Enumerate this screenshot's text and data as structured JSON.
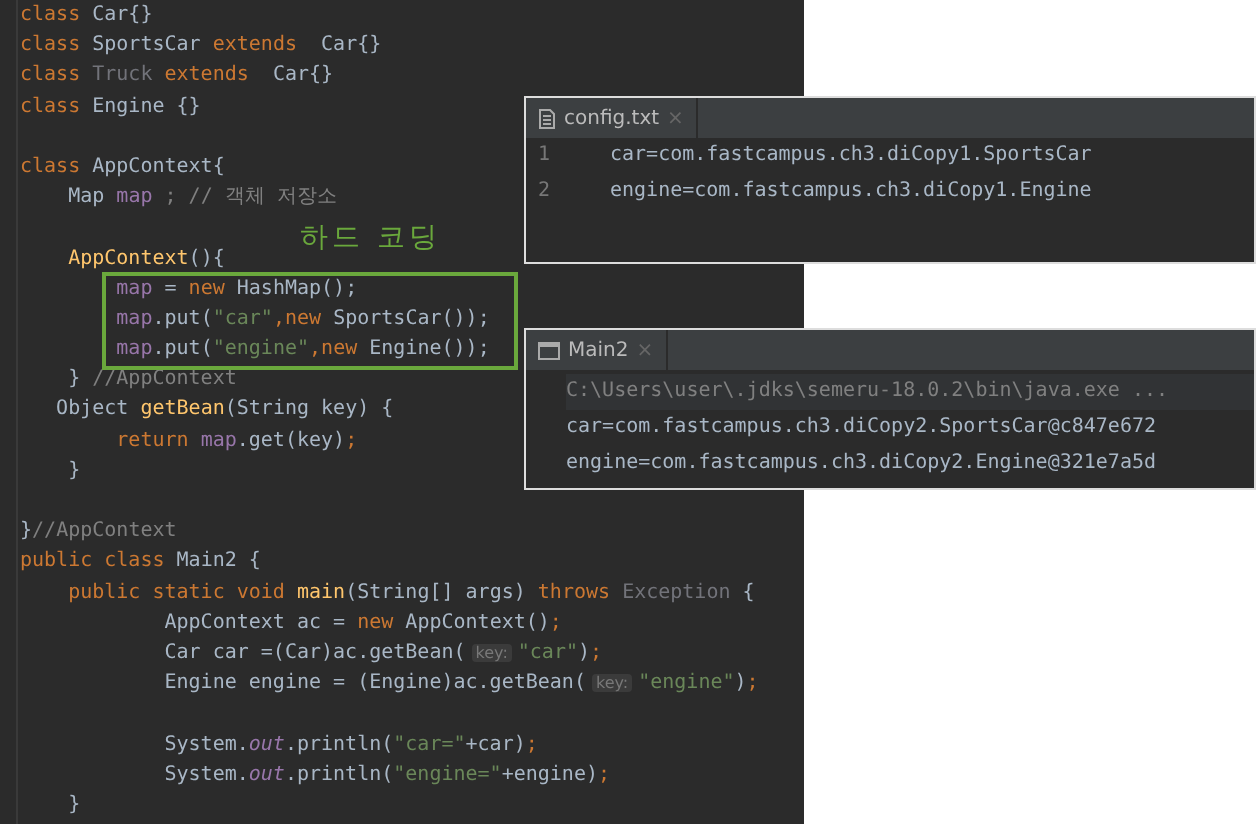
{
  "editor": {
    "lines": [
      {
        "tokens": [
          {
            "text": "class ",
            "kind": "kw"
          },
          {
            "text": "Car{}",
            "kind": "plain"
          }
        ]
      },
      {
        "tokens": [
          {
            "text": "class ",
            "kind": "kw"
          },
          {
            "text": "SportsCar ",
            "kind": "plain"
          },
          {
            "text": "extends  ",
            "kind": "kw"
          },
          {
            "text": "Car{}",
            "kind": "plain"
          }
        ]
      },
      {
        "tokens": [
          {
            "text": "class ",
            "kind": "kw"
          },
          {
            "text": "Truck ",
            "kind": "unused"
          },
          {
            "text": "extends  ",
            "kind": "kw"
          },
          {
            "text": "Car{}",
            "kind": "plain"
          }
        ]
      },
      {
        "tokens": [
          {
            "text": "class ",
            "kind": "kw"
          },
          {
            "text": "Engine {}",
            "kind": "plain"
          }
        ]
      },
      {
        "blank_before": true,
        "tokens": [
          {
            "text": "class ",
            "kind": "kw"
          },
          {
            "text": "AppContext{",
            "kind": "plain"
          }
        ]
      },
      {
        "tokens": [
          {
            "text": "    Map ",
            "kind": "plain"
          },
          {
            "text": "map ",
            "kind": "field"
          },
          {
            "text": "; // 객체 저장소",
            "kind": "comment"
          }
        ]
      },
      {
        "blank_before": true,
        "tokens": [
          {
            "text": "    AppContext",
            "kind": "fn"
          },
          {
            "text": "(){",
            "kind": "plain"
          }
        ]
      },
      {
        "tokens": [
          {
            "text": "        map ",
            "kind": "field"
          },
          {
            "text": "= ",
            "kind": "plain"
          },
          {
            "text": "new ",
            "kind": "kw"
          },
          {
            "text": "HashMap();",
            "kind": "plain"
          }
        ]
      },
      {
        "tokens": [
          {
            "text": "        map",
            "kind": "field"
          },
          {
            "text": ".put(",
            "kind": "plain"
          },
          {
            "text": "\"car\"",
            "kind": "str"
          },
          {
            "text": ",",
            "kind": "kw"
          },
          {
            "text": "new ",
            "kind": "kw"
          },
          {
            "text": "SportsCar());",
            "kind": "plain"
          }
        ]
      },
      {
        "tokens": [
          {
            "text": "        map",
            "kind": "field"
          },
          {
            "text": ".put(",
            "kind": "plain"
          },
          {
            "text": "\"engine\"",
            "kind": "str"
          },
          {
            "text": ",",
            "kind": "kw"
          },
          {
            "text": "new ",
            "kind": "kw"
          },
          {
            "text": "Engine());",
            "kind": "plain"
          }
        ]
      },
      {
        "tokens": [
          {
            "text": "    } ",
            "kind": "plain"
          },
          {
            "text": "//AppContext",
            "kind": "comment"
          }
        ]
      },
      {
        "tokens": [
          {
            "text": "   Object ",
            "kind": "plain"
          },
          {
            "text": "getBean",
            "kind": "fn"
          },
          {
            "text": "(String key) {",
            "kind": "plain"
          }
        ]
      },
      {
        "tokens": [
          {
            "text": "        return ",
            "kind": "kw"
          },
          {
            "text": "map",
            "kind": "field"
          },
          {
            "text": ".get(key)",
            "kind": "plain"
          },
          {
            "text": ";",
            "kind": "kw"
          }
        ]
      },
      {
        "tokens": [
          {
            "text": "    }",
            "kind": "plain"
          }
        ]
      },
      {
        "blank_before": true,
        "tokens": [
          {
            "text": "}",
            "kind": "plain"
          },
          {
            "text": "//AppContext",
            "kind": "comment"
          }
        ]
      },
      {
        "tokens": [
          {
            "text": "public class ",
            "kind": "kw"
          },
          {
            "text": "Main2 {",
            "kind": "plain"
          }
        ]
      },
      {
        "tokens": [
          {
            "text": "    public static void ",
            "kind": "kw"
          },
          {
            "text": "main",
            "kind": "fn"
          },
          {
            "text": "(String[] args) ",
            "kind": "plain"
          },
          {
            "text": "throws ",
            "kind": "kw"
          },
          {
            "text": "Exception ",
            "kind": "unused"
          },
          {
            "text": "{",
            "kind": "plain"
          }
        ]
      },
      {
        "tokens": [
          {
            "text": "            AppContext ac = ",
            "kind": "plain"
          },
          {
            "text": "new ",
            "kind": "kw"
          },
          {
            "text": "AppContext()",
            "kind": "plain"
          },
          {
            "text": ";",
            "kind": "kw"
          }
        ]
      },
      {
        "tokens": [
          {
            "text": "            Car car =(Car)ac.getBean(",
            "kind": "plain"
          },
          {
            "text": "key:",
            "kind": "hint"
          },
          {
            "text": "\"car\"",
            "kind": "str"
          },
          {
            "text": ")",
            "kind": "plain"
          },
          {
            "text": ";",
            "kind": "kw"
          }
        ]
      },
      {
        "tokens": [
          {
            "text": "            Engine engine = (Engine)ac.getBean(",
            "kind": "plain"
          },
          {
            "text": "key:",
            "kind": "hint"
          },
          {
            "text": "\"engine\"",
            "kind": "str"
          },
          {
            "text": ")",
            "kind": "plain"
          },
          {
            "text": ";",
            "kind": "kw"
          }
        ]
      },
      {
        "blank_before": true,
        "tokens": [
          {
            "text": "            System.",
            "kind": "plain"
          },
          {
            "text": "out",
            "kind": "static"
          },
          {
            "text": ".println(",
            "kind": "plain"
          },
          {
            "text": "\"car=\"",
            "kind": "str"
          },
          {
            "text": "+car)",
            "kind": "plain"
          },
          {
            "text": ";",
            "kind": "kw"
          }
        ]
      },
      {
        "tokens": [
          {
            "text": "            System.",
            "kind": "plain"
          },
          {
            "text": "out",
            "kind": "static"
          },
          {
            "text": ".println(",
            "kind": "plain"
          },
          {
            "text": "\"engine=\"",
            "kind": "str"
          },
          {
            "text": "+engine)",
            "kind": "plain"
          },
          {
            "text": ";",
            "kind": "kw"
          }
        ]
      },
      {
        "tokens": [
          {
            "text": "    }",
            "kind": "plain"
          }
        ]
      }
    ]
  },
  "annotation": {
    "label": "하드 코딩"
  },
  "config_panel": {
    "tab": {
      "title": "config.txt",
      "close": "×"
    },
    "lines": [
      {
        "number": "1",
        "text": "car=com.fastcampus.ch3.diCopy1.SportsCar"
      },
      {
        "number": "2",
        "text": "engine=com.fastcampus.ch3.diCopy1.Engine"
      }
    ]
  },
  "run_panel": {
    "tab": {
      "title": "Main2",
      "close": "×"
    },
    "output": [
      {
        "kind": "command",
        "text": "C:\\Users\\user\\.jdks\\semeru-18.0.2\\bin\\java.exe ..."
      },
      {
        "kind": "out",
        "text": "car=com.fastcampus.ch3.diCopy2.SportsCar@c847e672"
      },
      {
        "kind": "out",
        "text": "engine=com.fastcampus.ch3.diCopy2.Engine@321e7a5d"
      }
    ]
  }
}
